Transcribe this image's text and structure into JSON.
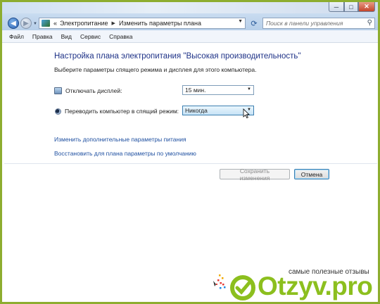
{
  "window": {
    "min_icon": "minimize-icon",
    "max_icon": "maximize-icon",
    "close_icon": "close-icon",
    "min_glyph": "─",
    "max_glyph": "□",
    "close_glyph": "✕"
  },
  "nav": {
    "back_glyph": "◀",
    "forward_glyph": "▶",
    "dropdown_glyph": "▼",
    "breadcrumb_sep": "«",
    "crumb1": "Электропитание",
    "crumb_arrow": "▶",
    "crumb2": "Изменить параметры плана",
    "refresh_glyph": "⟳"
  },
  "search": {
    "placeholder": "Поиск в панели управления",
    "icon_glyph": "⚲"
  },
  "menu": {
    "items": [
      "Файл",
      "Правка",
      "Вид",
      "Сервис",
      "Справка"
    ]
  },
  "main": {
    "title": "Настройка плана электропитания \"Высокая производительность\"",
    "subtitle": "Выберите параметры спящего режима и дисплея для этого компьютера.",
    "display_label": "Отключать дисплей:",
    "display_value": "15 мин.",
    "sleep_label": "Переводить компьютер в спящий режим:",
    "sleep_value": "Никогда",
    "caret_glyph": "▼",
    "link_advanced": "Изменить дополнительные параметры питания",
    "link_restore": "Восстановить для плана параметры по умолчанию"
  },
  "buttons": {
    "save": "Сохранить изменения",
    "cancel": "Отмена"
  },
  "watermark": {
    "tagline": "самые полезные отзывы",
    "brand": "Otzyv.pro",
    "accent": "#8cbf1e",
    "icon": "otzyv-logo-icon"
  },
  "colors": {
    "title_blue": "#1e3287",
    "link_blue": "#1e4fa0",
    "border_green": "#8dad2f"
  }
}
